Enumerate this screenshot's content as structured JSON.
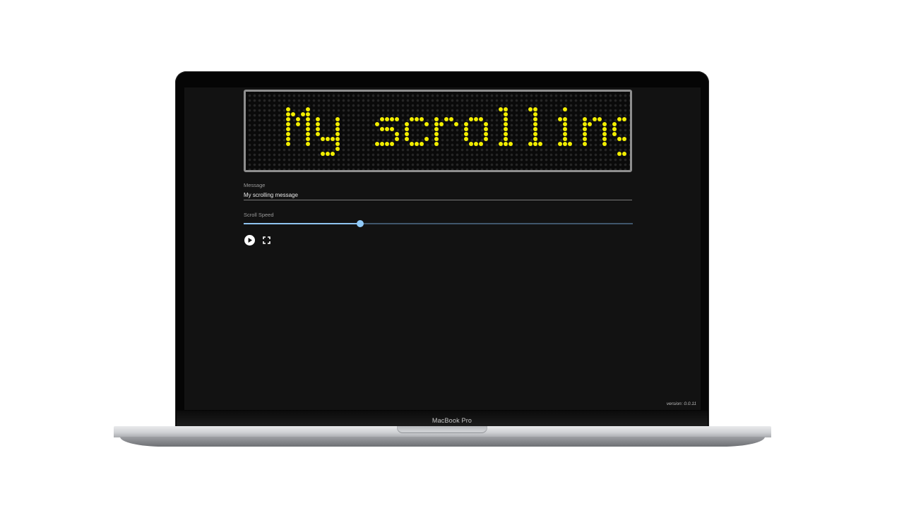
{
  "device": {
    "model_label": "MacBook Pro"
  },
  "app": {
    "led_sign": {
      "displayed_text": "My scrolling m",
      "led_color": "#f2ee00",
      "frame_color": "#8e8e8e"
    },
    "message_field": {
      "label": "Message",
      "value": "My scrolling message"
    },
    "scroll_speed": {
      "label": "Scroll Speed",
      "value_fraction": 0.3,
      "accent_color": "#90caf9"
    },
    "controls": {
      "play_icon": "play-circle-icon",
      "fullscreen_icon": "fullscreen-icon"
    },
    "version_text": "version: 0.0.11"
  }
}
